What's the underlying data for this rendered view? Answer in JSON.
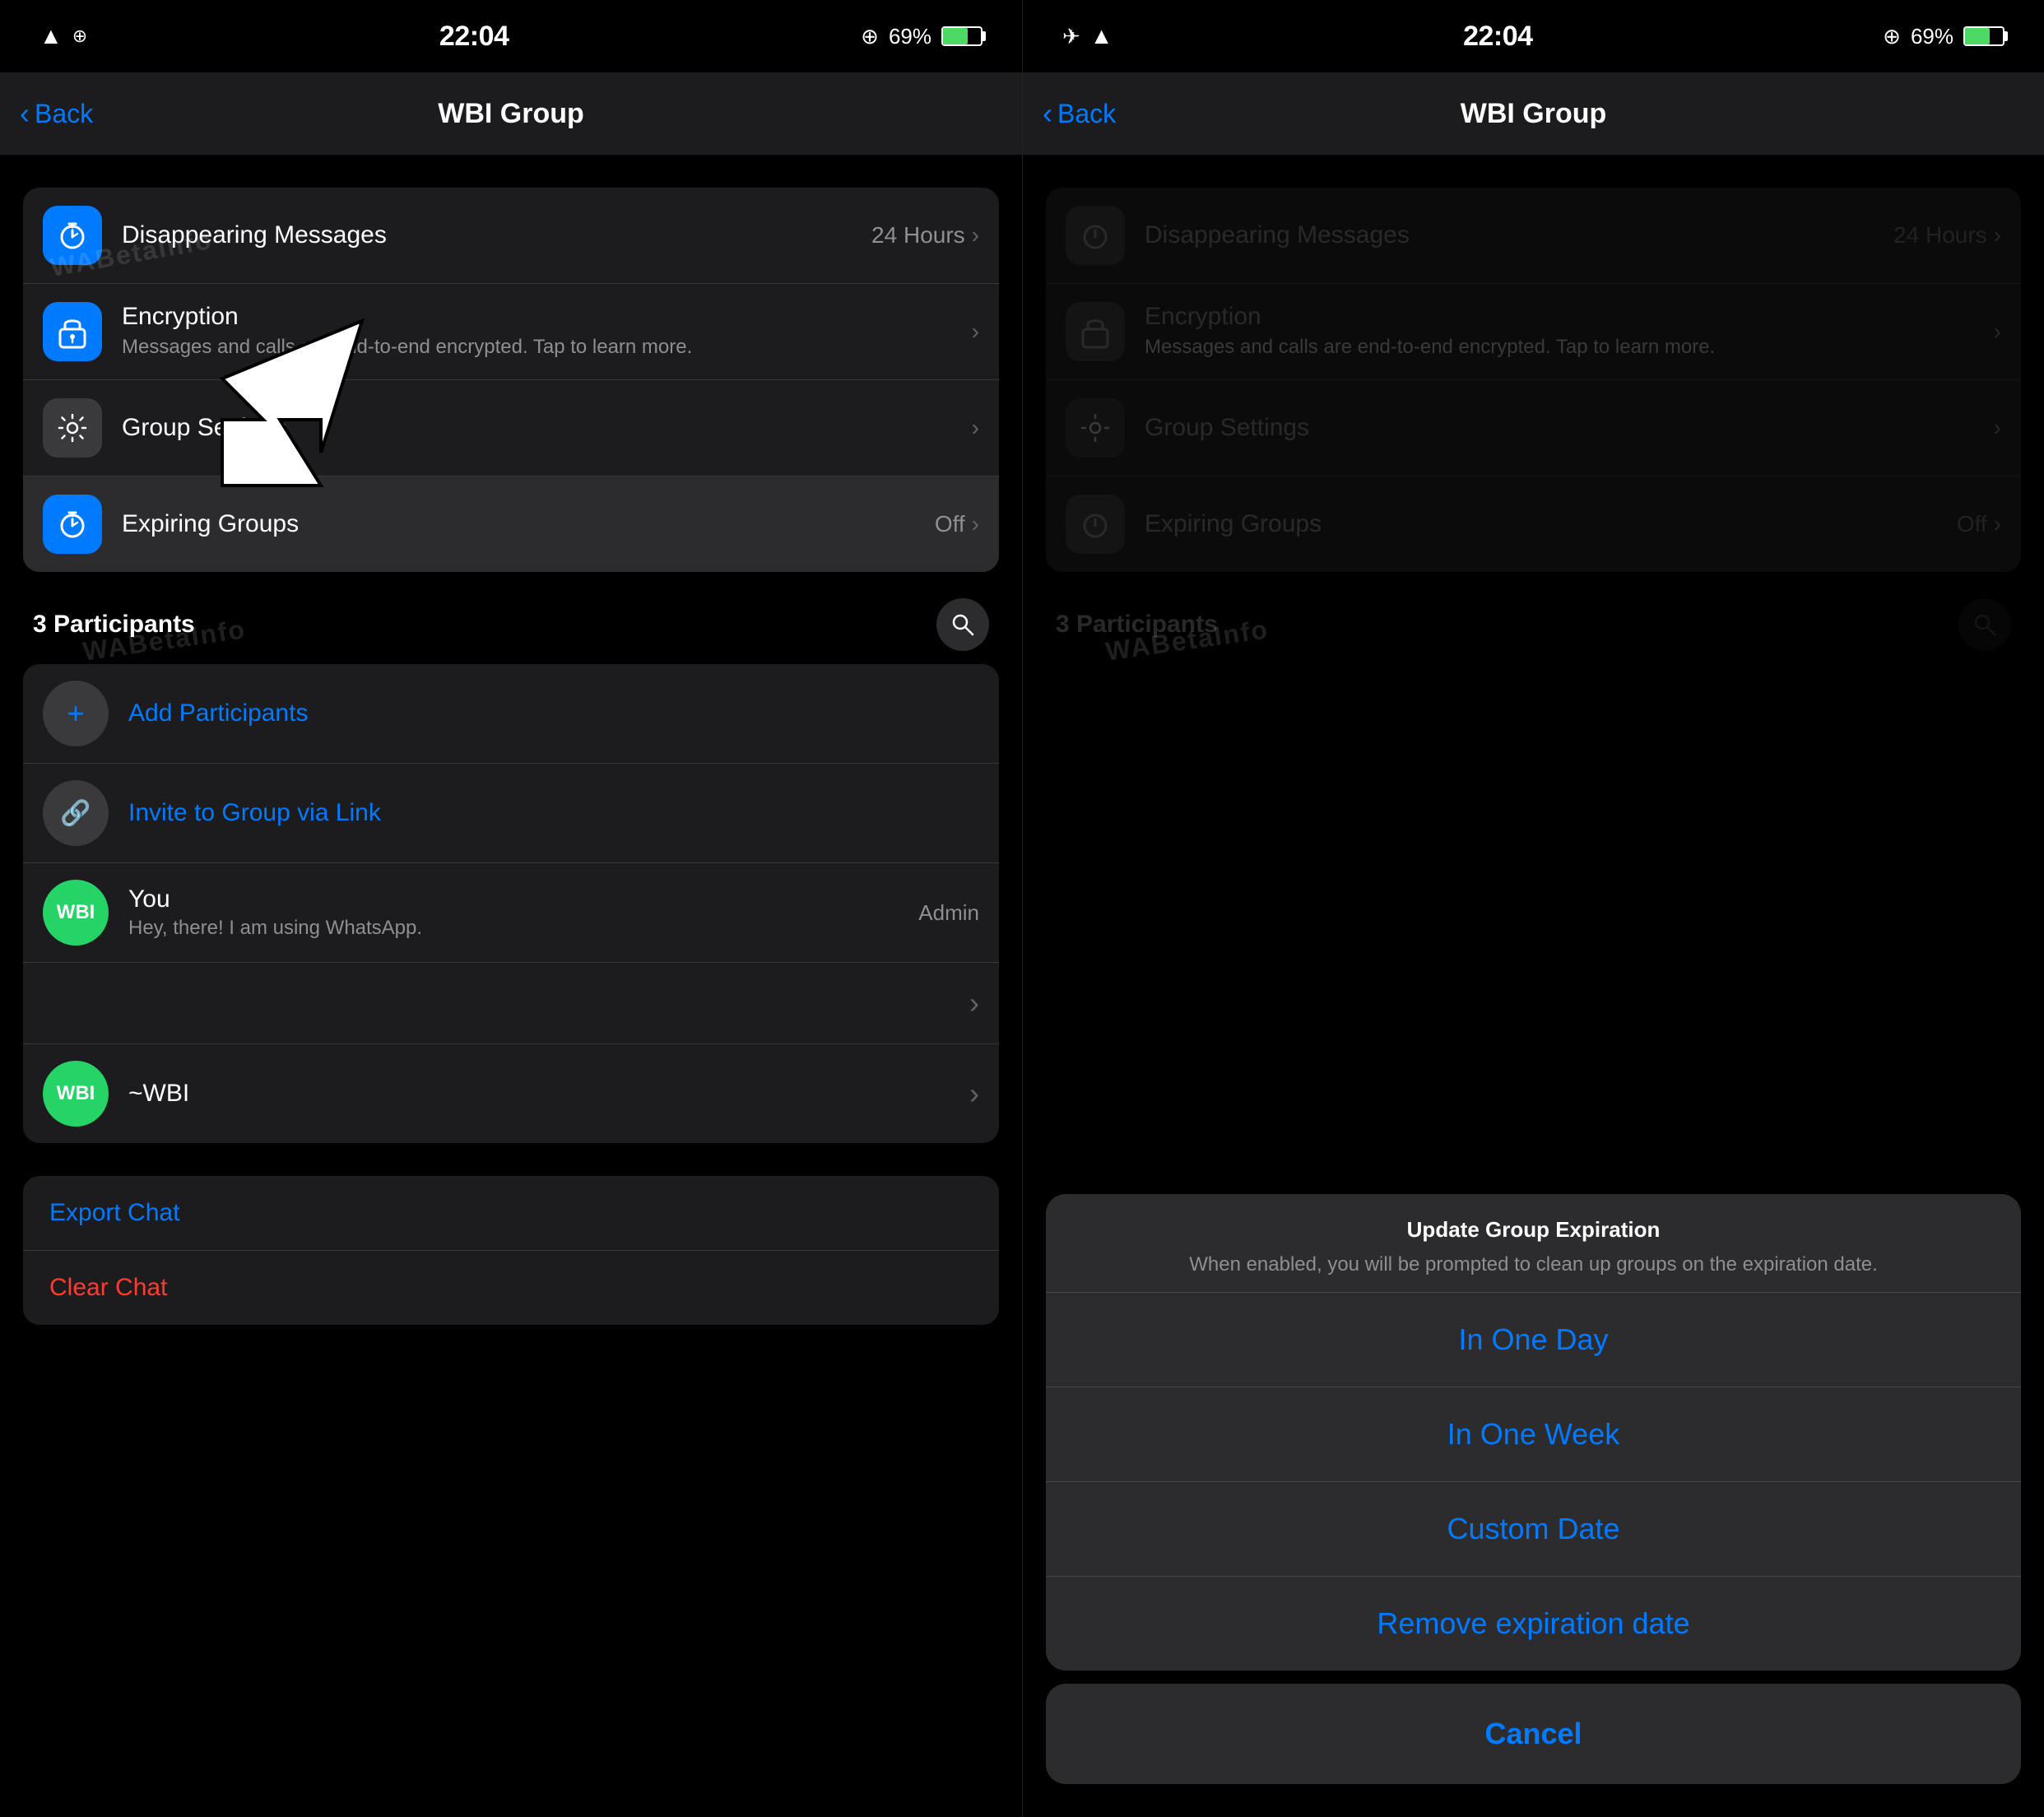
{
  "left": {
    "status": {
      "time": "22:04",
      "battery": "69%"
    },
    "nav": {
      "back_label": "Back",
      "title": "WBI Group"
    },
    "settings": [
      {
        "icon": "timer-icon",
        "icon_bg": "blue",
        "title": "Disappearing Messages",
        "value": "24 Hours"
      },
      {
        "icon": "lock-icon",
        "icon_bg": "blue",
        "title": "Encryption",
        "subtitle": "Messages and calls are end-to-end encrypted. Tap to learn more."
      },
      {
        "icon": "gear-icon",
        "icon_bg": "dark",
        "title": "Group Settings"
      },
      {
        "icon": "timer-icon",
        "icon_bg": "blue",
        "title": "Expiring Groups",
        "value": "Off",
        "highlighted": true
      }
    ],
    "participants_title": "3 Participants",
    "participants": [
      {
        "type": "add",
        "name": "Add Participants"
      },
      {
        "type": "link",
        "name": "Invite to Group via Link"
      },
      {
        "type": "user",
        "avatar": "WBI",
        "name": "You",
        "sub": "Hey, there! I am using WhatsApp.",
        "badge": "Admin"
      },
      {
        "type": "user",
        "avatar": "WBI",
        "name": "~WBI",
        "sub": ""
      }
    ],
    "actions": [
      {
        "label": "Export Chat",
        "color": "blue"
      },
      {
        "label": "Clear Chat",
        "color": "red"
      }
    ]
  },
  "right": {
    "status": {
      "time": "22:04",
      "battery": "69%"
    },
    "nav": {
      "back_label": "Back",
      "title": "WBI Group"
    },
    "settings": [
      {
        "icon": "timer-icon",
        "icon_bg": "blue",
        "title": "Disappearing Messages",
        "value": "24 Hours"
      },
      {
        "icon": "lock-icon",
        "icon_bg": "blue",
        "title": "Encryption",
        "subtitle": "Messages and calls are end-to-end encrypted. Tap to learn more."
      },
      {
        "icon": "gear-icon",
        "icon_bg": "dark",
        "title": "Group Settings"
      },
      {
        "icon": "timer-icon",
        "icon_bg": "blue",
        "title": "Expiring Groups",
        "value": "Off"
      }
    ],
    "participants_title": "3 Participants",
    "action_sheet": {
      "title": "Update Group Expiration",
      "subtitle": "When enabled, you will be prompted to clean up groups on the expiration date.",
      "options": [
        "In One Day",
        "In One Week",
        "Custom Date",
        "Remove expiration date"
      ],
      "cancel": "Cancel"
    }
  }
}
